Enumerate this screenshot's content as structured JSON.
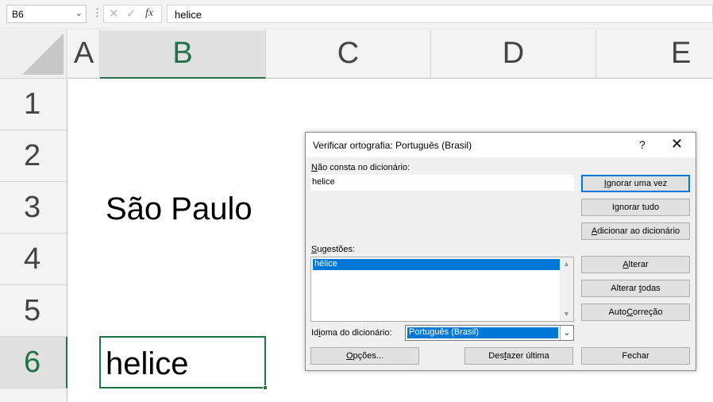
{
  "formula_bar": {
    "name_box": "B6",
    "formula": "helice",
    "fx_label": "fx",
    "dots": "⋮",
    "cancel_glyph": "✕",
    "enter_glyph": "✓",
    "dropdown_glyph": "⌄"
  },
  "sheet": {
    "columns": [
      "A",
      "B",
      "C",
      "D",
      "E"
    ],
    "rows": [
      "1",
      "2",
      "3",
      "4",
      "5",
      "6"
    ],
    "selected_cell": "B6",
    "cells": {
      "B3": "São Paulo",
      "B6": "helice"
    },
    "accent_color": "#217346"
  },
  "dialog": {
    "title": "Verificar ortografia: Português (Brasil)",
    "help_glyph": "?",
    "close_glyph": "✕",
    "not_in_dict": {
      "label_mnemonic": "N",
      "label_rest": "ão consta no dicionário:",
      "value": "helice"
    },
    "suggestions": {
      "label_mnemonic": "S",
      "label_rest": "ugestões:",
      "items": [
        "hélice"
      ],
      "selected": "hélice",
      "scroll_up": "▲",
      "scroll_down": "▼"
    },
    "dictionary_language": {
      "label_pre": "Id",
      "label_mnemonic": "i",
      "label_rest": "oma do dicionário:",
      "value": "Português (Brasil)",
      "arrow": "⌄"
    },
    "buttons": {
      "ignore_once": {
        "pre": "",
        "mn": "I",
        "post": "gnorar uma vez"
      },
      "ignore_all": {
        "pre": "I",
        "mn": "g",
        "post": "norar tudo"
      },
      "add_to_dict": {
        "pre": "",
        "mn": "A",
        "post": "dicionar ao dicionário"
      },
      "change": {
        "pre": "",
        "mn": "A",
        "post": "lterar"
      },
      "change_all": {
        "pre": "Alterar ",
        "mn": "t",
        "post": "odas"
      },
      "autocorrect": {
        "pre": "Auto",
        "mn": "C",
        "post": "orreção"
      },
      "options": {
        "pre": "",
        "mn": "O",
        "post": "pções..."
      },
      "undo_last": {
        "pre": "Des",
        "mn": "f",
        "post": "azer última"
      },
      "close": {
        "pre": "Fechar",
        "mn": "",
        "post": ""
      }
    },
    "highlight_color": "#0078d7"
  }
}
